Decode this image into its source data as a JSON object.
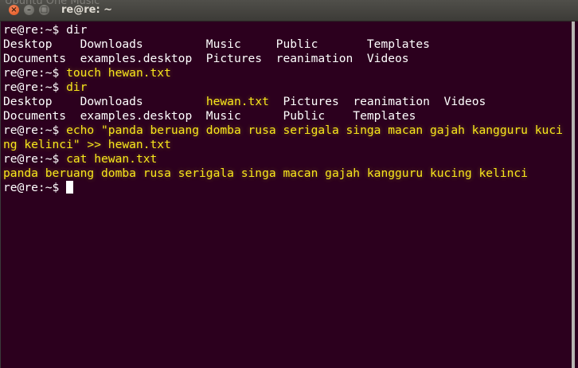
{
  "window": {
    "title": "re@re: ~",
    "ghost_title": "Ubuntu One Music",
    "close_glyph": "×",
    "min_glyph": "–",
    "max_glyph": "□"
  },
  "terminal": {
    "prompt": "re@re:~$ ",
    "line1_cmd": "dir",
    "line2": "Desktop    Downloads         Music     Public       Templates",
    "line3": "Documents  examples.desktop  Pictures  reanimation  Videos",
    "line4_cmd": "touch hewan.txt",
    "line5_cmd": "dir",
    "line6_a": "Desktop    Downloads         ",
    "line6_hl": "hewan.txt",
    "line6_b": "  Pictures  reanimation  Videos",
    "line7": "Documents  examples.desktop  Music      Public    Templates",
    "line8_cmd": "echo \"panda beruang domba rusa serigala singa macan gajah kangguru kuci",
    "line9": "ng kelinci\" >> hewan.txt",
    "line10_cmd": "cat hewan.txt",
    "line11": "panda beruang domba rusa serigala singa macan gajah kangguru kucing kelinci"
  },
  "colors": {
    "background": "#2c001e",
    "text": "#ffffff",
    "highlight": "#f8e71c"
  }
}
